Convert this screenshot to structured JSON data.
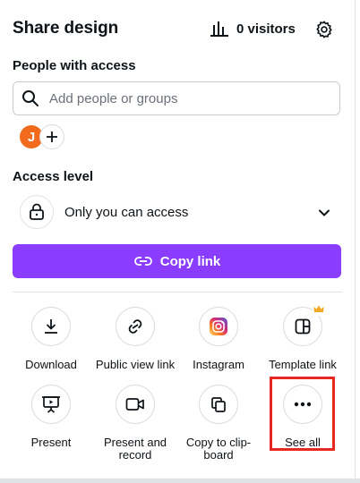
{
  "header": {
    "title": "Share design",
    "visitors_label": "0 visitors",
    "visitors_icon": "bar-chart-icon",
    "settings_icon": "gear-icon"
  },
  "people": {
    "label": "People with access",
    "search_placeholder": "Add people or groups",
    "search_value": "",
    "avatar_initial": "J",
    "avatar_color": "#f26b1d"
  },
  "access": {
    "label": "Access level",
    "value": "Only you can access",
    "icon": "lock-icon"
  },
  "copy_link": {
    "label": "Copy link",
    "color": "#8b3dff",
    "icon": "link-icon"
  },
  "options": [
    {
      "label": "Download",
      "icon": "download-icon"
    },
    {
      "label": "Public view link",
      "icon": "link-icon"
    },
    {
      "label": "Instagram",
      "icon": "instagram-icon"
    },
    {
      "label": "Template link",
      "icon": "template-icon",
      "premium": true
    },
    {
      "label": "Present",
      "icon": "present-icon"
    },
    {
      "label": "Present and record",
      "icon": "video-camera-icon"
    },
    {
      "label": "Copy to clip-board",
      "icon": "copy-icon"
    },
    {
      "label": "See all",
      "icon": "more-dots-icon"
    }
  ],
  "highlight_color": "#e8281e"
}
